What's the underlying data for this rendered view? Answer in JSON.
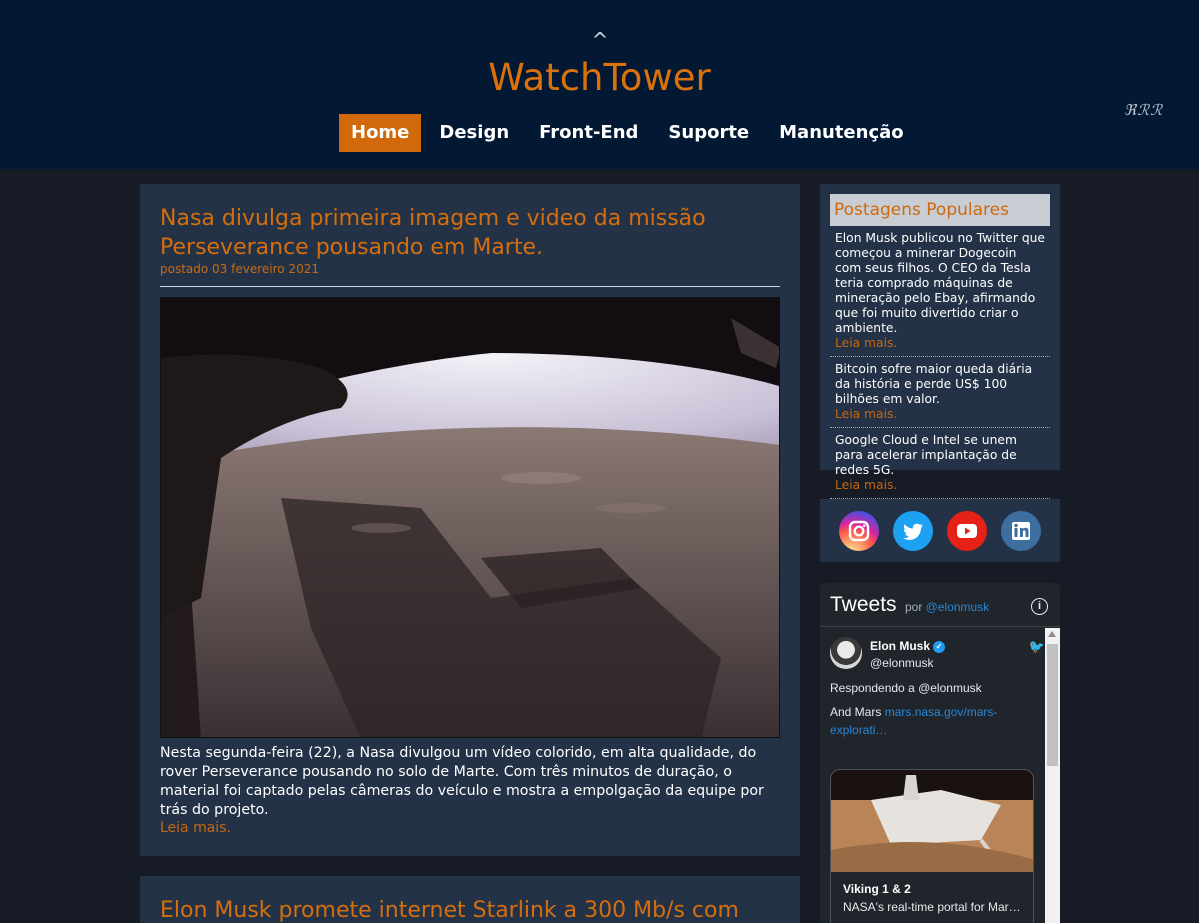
{
  "header": {
    "logo_caret": "^",
    "logo_text": "WatchTower",
    "nav": [
      {
        "label": "Home",
        "active": true
      },
      {
        "label": "Design",
        "active": false
      },
      {
        "label": "Front-End",
        "active": false
      },
      {
        "label": "Suporte",
        "active": false
      },
      {
        "label": "Manutenção",
        "active": false
      }
    ],
    "lang_icons": "ℜℛℛ"
  },
  "articles": [
    {
      "title": "Nasa divulga primeira imagem e video da missão Perseverance pousando em Marte.",
      "date": "postado 03 fevereiro 2021",
      "image_icon": "mars-landscape-photo",
      "body": "Nesta segunda-feira (22), a Nasa divulgou um vídeo colorido, em alta qualidade, do rover Perseverance pousando no solo de Marte. Com três minutos de duração, o material foi captado pelas câmeras do veículo e mostra a empolgação da equipe por trás do projeto.",
      "read_more": "Leia mais."
    },
    {
      "title": "Elon Musk promete internet Starlink a 300 Mb/s com"
    }
  ],
  "popular": {
    "title": "Postagens Populares",
    "items": [
      {
        "text": "Elon Musk publicou no Twitter que começou a minerar Dogecoin com seus filhos. O CEO da Tesla teria comprado máquinas de mineração pelo Ebay, afirmando que foi muito divertido criar o ambiente.",
        "read_more": "Leia mais."
      },
      {
        "text": "Bitcoin sofre maior queda diária da história e perde US$ 100 bilhões em valor.",
        "read_more": "Leia mais."
      },
      {
        "text": "Google Cloud e Intel se unem para acelerar implantação de redes 5G.",
        "read_more": "Leia mais."
      }
    ]
  },
  "social": {
    "icons": [
      "instagram-icon",
      "twitter-icon",
      "youtube-icon",
      "linkedin-icon"
    ],
    "colors": {
      "instagram": "#d6249f",
      "twitter": "#1da1f2",
      "youtube": "#e62117",
      "linkedin": "#0e76a8"
    }
  },
  "tweets": {
    "title": "Tweets",
    "by": "por",
    "handle_link": "@elonmusk",
    "tweet": {
      "name": "Elon Musk",
      "handle": "@elonmusk",
      "reply": "Respondendo a @elonmusk",
      "text": "And Mars",
      "link": "mars.nasa.gov/mars-explorati…",
      "card_title": "Viking 1 & 2",
      "card_desc": "NASA's real-time portal for Mar…"
    }
  },
  "colors": {
    "header_bg": "#021833",
    "page_bg": "#161b25",
    "panel_bg": "#233246",
    "accent": "#d1680a"
  }
}
